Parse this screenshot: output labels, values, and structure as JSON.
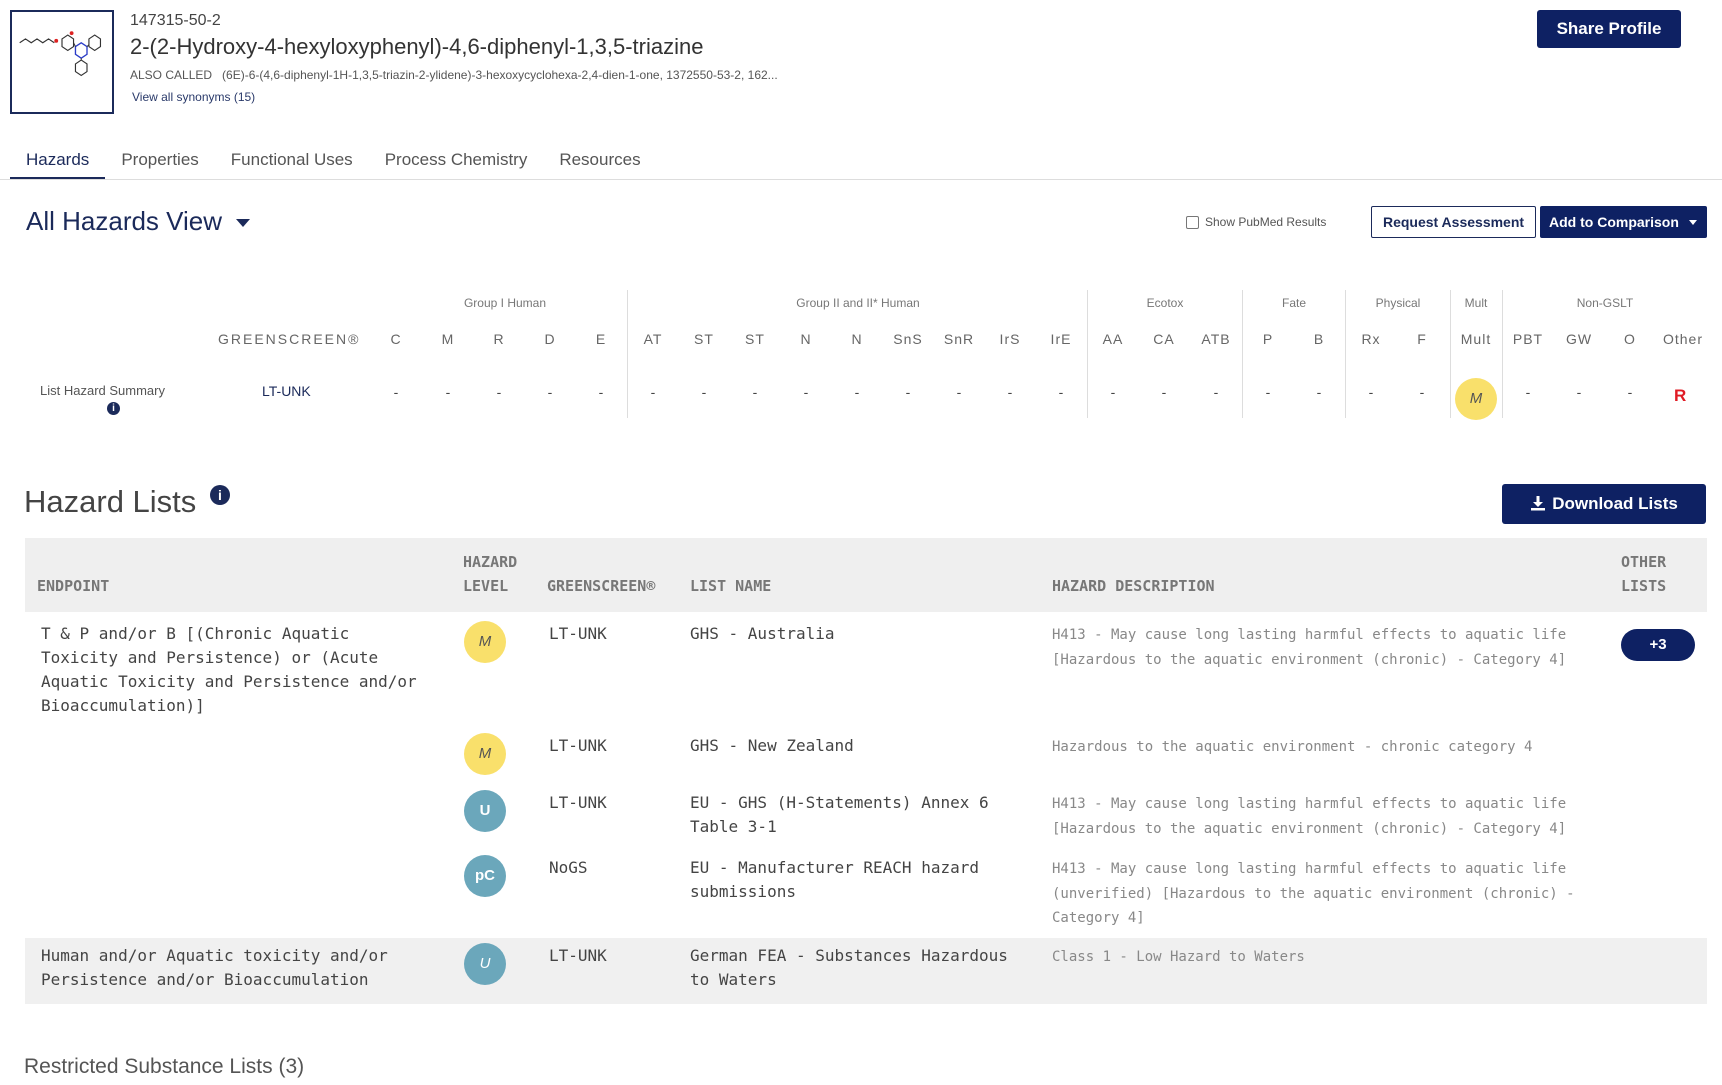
{
  "header": {
    "cas": "147315-50-2",
    "title": "2-(2-Hydroxy-4-hexyloxyphenyl)-4,6-diphenyl-1,3,5-triazine",
    "also_label": "ALSO CALLED",
    "also_value": "(6E)-6-(4,6-diphenyl-1H-1,3,5-triazin-2-ylidene)-3-hexoxycyclohexa-2,4-dien-1-one, 1372550-53-2, 162...",
    "synonyms_link": "View all synonyms (15)",
    "share_label": "Share Profile"
  },
  "tabs": [
    {
      "label": "Hazards",
      "active": true
    },
    {
      "label": "Properties"
    },
    {
      "label": "Functional Uses"
    },
    {
      "label": "Process Chemistry"
    },
    {
      "label": "Resources"
    }
  ],
  "view": {
    "title": "All Hazards View",
    "pubmed_label": "Show PubMed Results",
    "request_label": "Request Assessment",
    "compare_label": "Add to Comparison"
  },
  "summary": {
    "groups": [
      "Group I Human",
      "Group II and II* Human",
      "Ecotox",
      "Fate",
      "Physical",
      "Mult",
      "Non-GSLT"
    ],
    "greenscreen_header": "GREENSCREEN®",
    "columns": [
      "C",
      "M",
      "R",
      "D",
      "E",
      "AT",
      "ST",
      "ST",
      "N",
      "N",
      "SnS",
      "SnR",
      "IrS",
      "IrE",
      "AA",
      "CA",
      "ATB",
      "P",
      "B",
      "Rx",
      "F",
      "Mult",
      "PBT",
      "GW",
      "O",
      "Other"
    ],
    "row_label": "List Hazard Summary",
    "row_greenscreen": "LT-UNK",
    "dash": "-",
    "mult_value": "M",
    "other_value": "R",
    "info_glyph": "i"
  },
  "hazard_lists": {
    "title": "Hazard Lists",
    "info_glyph": "i",
    "download_label": "Download Lists",
    "headers": {
      "endpoint": "ENDPOINT",
      "level_1": "HAZARD",
      "level_2": "LEVEL",
      "greenscreen": "GREENSCREEN®",
      "list_name": "LIST NAME",
      "description": "HAZARD DESCRIPTION",
      "other_1": "OTHER",
      "other_2": "LISTS"
    },
    "rows": [
      {
        "endpoint": [
          "T & P and/or B [(Chronic Aquatic",
          "Toxicity and Persistence) or (Acute",
          "Aquatic Toxicity and Persistence and/or",
          "Bioaccumulation)]"
        ],
        "level": "M",
        "greenscreen": "LT-UNK",
        "list_name": [
          "GHS - Australia"
        ],
        "description": [
          "H413 - May cause long lasting harmful effects to aquatic life",
          "[Hazardous to the aquatic environment (chronic) - Category 4]"
        ],
        "other": "+3"
      },
      {
        "level": "M",
        "greenscreen": "LT-UNK",
        "list_name": [
          "GHS - New Zealand"
        ],
        "description": [
          "Hazardous to the aquatic environment - chronic category 4"
        ]
      },
      {
        "level": "U",
        "greenscreen": "LT-UNK",
        "list_name": [
          "EU - GHS (H-Statements) Annex 6",
          "Table 3-1"
        ],
        "description": [
          "H413 - May cause long lasting harmful effects to aquatic life",
          "[Hazardous to the aquatic environment (chronic) - Category 4]"
        ]
      },
      {
        "level": "pC",
        "greenscreen": "NoGS",
        "list_name": [
          "EU - Manufacturer REACH hazard",
          "submissions"
        ],
        "description": [
          "H413 - May cause long lasting harmful effects to aquatic life",
          "(unverified) [Hazardous to the aquatic environment (chronic) -",
          "Category 4]"
        ]
      },
      {
        "endpoint": [
          "Human and/or Aquatic toxicity and/or",
          "Persistence and/or Bioaccumulation"
        ],
        "level": "U",
        "greenscreen": "LT-UNK",
        "list_name": [
          "German FEA - Substances Hazardous",
          "to Waters"
        ],
        "description": [
          "Class 1 - Low Hazard to Waters"
        ]
      }
    ]
  },
  "restricted": {
    "label": "Restricted Substance Lists (3)"
  },
  "colors": {
    "navy": "#0e2163",
    "level_m": "#f9e06b",
    "level_u": "#6ba7bb",
    "flag_red": "#e01b24"
  }
}
